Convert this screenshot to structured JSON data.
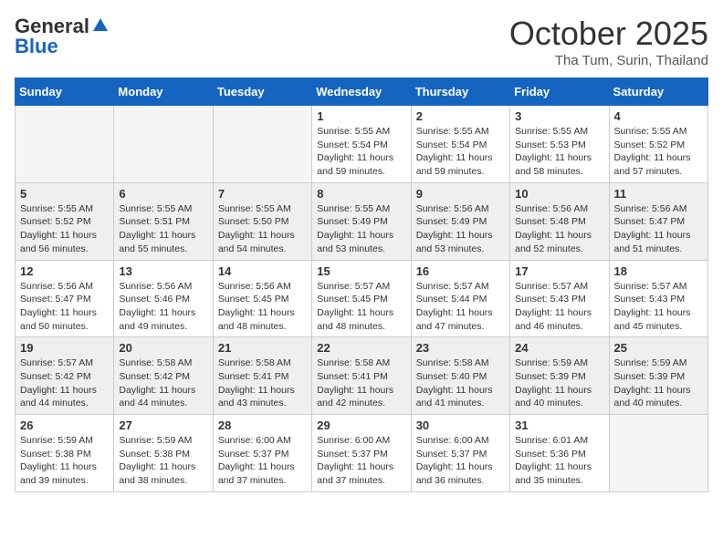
{
  "header": {
    "logo_general": "General",
    "logo_blue": "Blue",
    "month_title": "October 2025",
    "subtitle": "Tha Tum, Surin, Thailand"
  },
  "days_of_week": [
    "Sunday",
    "Monday",
    "Tuesday",
    "Wednesday",
    "Thursday",
    "Friday",
    "Saturday"
  ],
  "weeks": [
    [
      {
        "day": "",
        "info": ""
      },
      {
        "day": "",
        "info": ""
      },
      {
        "day": "",
        "info": ""
      },
      {
        "day": "1",
        "info": "Sunrise: 5:55 AM\nSunset: 5:54 PM\nDaylight: 11 hours\nand 59 minutes."
      },
      {
        "day": "2",
        "info": "Sunrise: 5:55 AM\nSunset: 5:54 PM\nDaylight: 11 hours\nand 59 minutes."
      },
      {
        "day": "3",
        "info": "Sunrise: 5:55 AM\nSunset: 5:53 PM\nDaylight: 11 hours\nand 58 minutes."
      },
      {
        "day": "4",
        "info": "Sunrise: 5:55 AM\nSunset: 5:52 PM\nDaylight: 11 hours\nand 57 minutes."
      }
    ],
    [
      {
        "day": "5",
        "info": "Sunrise: 5:55 AM\nSunset: 5:52 PM\nDaylight: 11 hours\nand 56 minutes."
      },
      {
        "day": "6",
        "info": "Sunrise: 5:55 AM\nSunset: 5:51 PM\nDaylight: 11 hours\nand 55 minutes."
      },
      {
        "day": "7",
        "info": "Sunrise: 5:55 AM\nSunset: 5:50 PM\nDaylight: 11 hours\nand 54 minutes."
      },
      {
        "day": "8",
        "info": "Sunrise: 5:55 AM\nSunset: 5:49 PM\nDaylight: 11 hours\nand 53 minutes."
      },
      {
        "day": "9",
        "info": "Sunrise: 5:56 AM\nSunset: 5:49 PM\nDaylight: 11 hours\nand 53 minutes."
      },
      {
        "day": "10",
        "info": "Sunrise: 5:56 AM\nSunset: 5:48 PM\nDaylight: 11 hours\nand 52 minutes."
      },
      {
        "day": "11",
        "info": "Sunrise: 5:56 AM\nSunset: 5:47 PM\nDaylight: 11 hours\nand 51 minutes."
      }
    ],
    [
      {
        "day": "12",
        "info": "Sunrise: 5:56 AM\nSunset: 5:47 PM\nDaylight: 11 hours\nand 50 minutes."
      },
      {
        "day": "13",
        "info": "Sunrise: 5:56 AM\nSunset: 5:46 PM\nDaylight: 11 hours\nand 49 minutes."
      },
      {
        "day": "14",
        "info": "Sunrise: 5:56 AM\nSunset: 5:45 PM\nDaylight: 11 hours\nand 48 minutes."
      },
      {
        "day": "15",
        "info": "Sunrise: 5:57 AM\nSunset: 5:45 PM\nDaylight: 11 hours\nand 48 minutes."
      },
      {
        "day": "16",
        "info": "Sunrise: 5:57 AM\nSunset: 5:44 PM\nDaylight: 11 hours\nand 47 minutes."
      },
      {
        "day": "17",
        "info": "Sunrise: 5:57 AM\nSunset: 5:43 PM\nDaylight: 11 hours\nand 46 minutes."
      },
      {
        "day": "18",
        "info": "Sunrise: 5:57 AM\nSunset: 5:43 PM\nDaylight: 11 hours\nand 45 minutes."
      }
    ],
    [
      {
        "day": "19",
        "info": "Sunrise: 5:57 AM\nSunset: 5:42 PM\nDaylight: 11 hours\nand 44 minutes."
      },
      {
        "day": "20",
        "info": "Sunrise: 5:58 AM\nSunset: 5:42 PM\nDaylight: 11 hours\nand 44 minutes."
      },
      {
        "day": "21",
        "info": "Sunrise: 5:58 AM\nSunset: 5:41 PM\nDaylight: 11 hours\nand 43 minutes."
      },
      {
        "day": "22",
        "info": "Sunrise: 5:58 AM\nSunset: 5:41 PM\nDaylight: 11 hours\nand 42 minutes."
      },
      {
        "day": "23",
        "info": "Sunrise: 5:58 AM\nSunset: 5:40 PM\nDaylight: 11 hours\nand 41 minutes."
      },
      {
        "day": "24",
        "info": "Sunrise: 5:59 AM\nSunset: 5:39 PM\nDaylight: 11 hours\nand 40 minutes."
      },
      {
        "day": "25",
        "info": "Sunrise: 5:59 AM\nSunset: 5:39 PM\nDaylight: 11 hours\nand 40 minutes."
      }
    ],
    [
      {
        "day": "26",
        "info": "Sunrise: 5:59 AM\nSunset: 5:38 PM\nDaylight: 11 hours\nand 39 minutes."
      },
      {
        "day": "27",
        "info": "Sunrise: 5:59 AM\nSunset: 5:38 PM\nDaylight: 11 hours\nand 38 minutes."
      },
      {
        "day": "28",
        "info": "Sunrise: 6:00 AM\nSunset: 5:37 PM\nDaylight: 11 hours\nand 37 minutes."
      },
      {
        "day": "29",
        "info": "Sunrise: 6:00 AM\nSunset: 5:37 PM\nDaylight: 11 hours\nand 37 minutes."
      },
      {
        "day": "30",
        "info": "Sunrise: 6:00 AM\nSunset: 5:37 PM\nDaylight: 11 hours\nand 36 minutes."
      },
      {
        "day": "31",
        "info": "Sunrise: 6:01 AM\nSunset: 5:36 PM\nDaylight: 11 hours\nand 35 minutes."
      },
      {
        "day": "",
        "info": ""
      }
    ]
  ]
}
